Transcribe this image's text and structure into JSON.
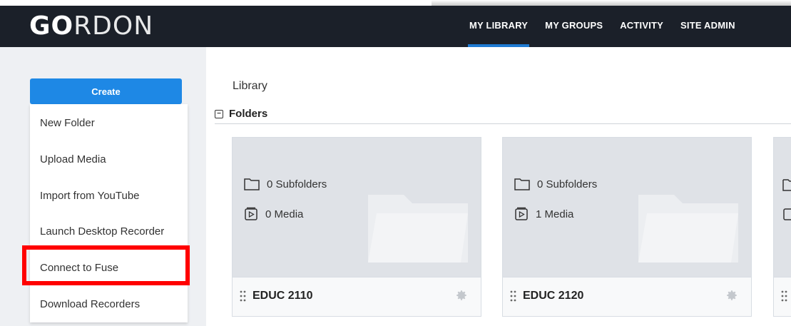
{
  "header": {
    "logo_bold": "GO",
    "logo_thin": "RDON",
    "nav": [
      "MY LIBRARY",
      "MY GROUPS",
      "ACTIVITY",
      "SITE ADMIN"
    ],
    "active_nav": "MY LIBRARY"
  },
  "sidebar": {
    "create_label": "Create",
    "menu": [
      "New Folder",
      "Upload Media",
      "Import from YouTube",
      "Launch Desktop Recorder",
      "Connect to Fuse",
      "Download Recorders"
    ],
    "highlighted_item": "Connect to Fuse",
    "highlight_color": "#ff0000"
  },
  "main": {
    "breadcrumb": "Library",
    "section_title": "Folders",
    "section_toggle": "−",
    "folders": [
      {
        "name": "EDUC 2110",
        "subfolders": "0 Subfolders",
        "media": "0 Media"
      },
      {
        "name": "EDUC 2120",
        "subfolders": "0 Subfolders",
        "media": "1 Media"
      }
    ]
  },
  "colors": {
    "header_bg": "#1b2029",
    "accent": "#1e88e5",
    "card_thumb": "#dfe2e7"
  },
  "icons": {
    "folder_outline": "folder-icon",
    "media": "media-icon",
    "drag": "drag-handle-icon",
    "gear": "gear-icon"
  }
}
